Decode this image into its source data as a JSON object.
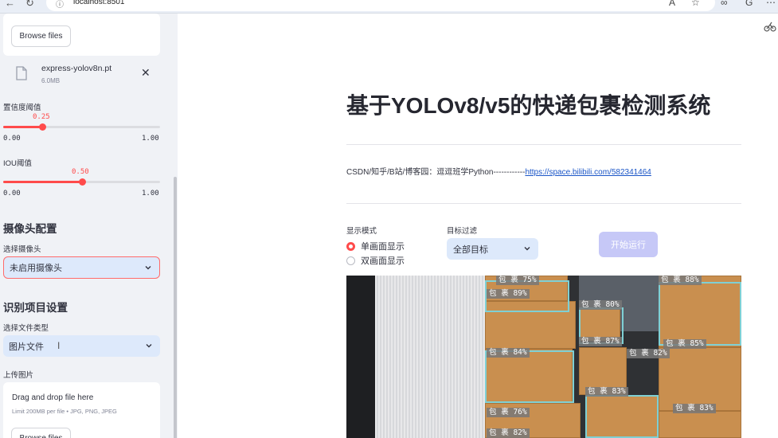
{
  "browser": {
    "url": "localhost:8501"
  },
  "sidebar": {
    "model_upload": {
      "browse_label": "Browse files",
      "file_name": "express-yolov8n.pt",
      "file_size": "6.0MB"
    },
    "conf_slider": {
      "label": "置信度阈值",
      "value": "0.25",
      "value_fraction": 0.25,
      "min": "0.00",
      "max": "1.00"
    },
    "iou_slider": {
      "label": "IOU阈值",
      "value": "0.50",
      "value_fraction": 0.5,
      "min": "0.00",
      "max": "1.00"
    },
    "camera_section": {
      "heading": "摄像头配置",
      "select_label": "选择摄像头",
      "select_value": "未启用摄像头"
    },
    "project_section": {
      "heading": "识别项目设置",
      "file_type_label": "选择文件类型",
      "file_type_value": "图片文件",
      "upload_label": "上传图片",
      "drop_title": "Drag and drop file here",
      "drop_sub": "Limit 200MB per file • JPG, PNG, JPEG",
      "browse_label": "Browse files"
    }
  },
  "main": {
    "title": "基于YOLOv8/v5的快递包裹检测系统",
    "credit_text": "CSDN/知乎/B站/博客园：逗逗班学Python------------",
    "credit_link": "https://space.bilibili.com/582341464",
    "display_mode": {
      "label": "显示模式",
      "options": [
        "单画面显示",
        "双画面显示"
      ],
      "selected": "单画面显示"
    },
    "target_filter": {
      "label": "目标过滤",
      "value": "全部目标"
    },
    "run_button": "开始运行",
    "detections": [
      {
        "label": "包 裹 75%"
      },
      {
        "label": "包 裹 88%"
      },
      {
        "label": "包 裹 89%"
      },
      {
        "label": "包 裹 80%"
      },
      {
        "label": "包 裹 87%"
      },
      {
        "label": "包 裹 85%"
      },
      {
        "label": "包 裹 84%"
      },
      {
        "label": "包 裹 82%"
      },
      {
        "label": "包 裹 83%"
      },
      {
        "label": "包 裹 76%"
      },
      {
        "label": "包 裹 83%"
      },
      {
        "label": "包 裹 82%"
      }
    ]
  },
  "colors": {
    "accent": "#ff4b4b",
    "sidebar_bg": "#f0f2f6",
    "select_bg": "#dde9fb",
    "run_button_bg": "#c6c8f7",
    "link": "#1a55c7"
  }
}
